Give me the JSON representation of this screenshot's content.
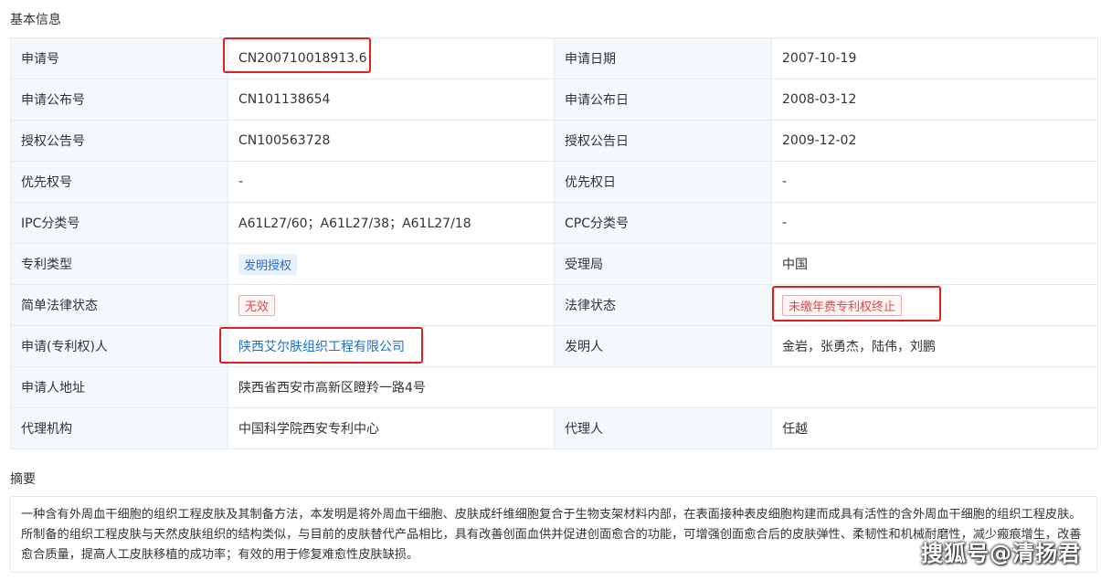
{
  "sections": {
    "basic_info": "基本信息",
    "abstract": "摘要"
  },
  "rows": [
    {
      "label1": "申请号",
      "value1": "CN200710018913.6",
      "label2": "申请日期",
      "value2": "2007-10-19"
    },
    {
      "label1": "申请公布号",
      "value1": "CN101138654",
      "label2": "申请公布日",
      "value2": "2008-03-12"
    },
    {
      "label1": "授权公告号",
      "value1": "CN100563728",
      "label2": "授权公告日",
      "value2": "2009-12-02"
    },
    {
      "label1": "优先权号",
      "value1": "-",
      "label2": "优先权日",
      "value2": "-"
    },
    {
      "label1": "IPC分类号",
      "value1": "A61L27/60；A61L27/38；A61L27/18",
      "label2": "CPC分类号",
      "value2": "-"
    },
    {
      "label1": "专利类型",
      "value1": "发明授权",
      "label2": "受理局",
      "value2": "中国"
    },
    {
      "label1": "简单法律状态",
      "value1": "无效",
      "label2": "法律状态",
      "value2": "未缴年费专利权终止"
    },
    {
      "label1": "申请(专利权)人",
      "value1": "陕西艾尔肤组织工程有限公司",
      "label2": "发明人",
      "value2": "金岩，张勇杰，陆伟，刘鹏"
    },
    {
      "label1": "申请人地址",
      "value1": "陕西省西安市高新区瞪羚一路4号"
    },
    {
      "label1": "代理机构",
      "value1": "中国科学院西安专利中心",
      "label2": "代理人",
      "value2": "任越"
    }
  ],
  "abstract_text": "一种含有外周血干细胞的组织工程皮肤及其制备方法，本发明是将外周血干细胞、皮肤成纤维细胞复合于生物支架材料内部，在表面接种表皮细胞构建而成具有活性的含外周血干细胞的组织工程皮肤。所制备的组织工程皮肤与天然皮肤组织的结构类似，与目前的皮肤替代产品相比，具有改善创面血供并促进创面愈合的功能，可增强创面愈合后的皮肤弹性、柔韧性和机械耐磨性，减少瘢痕增生，改善愈合质量，提高人工皮肤移植的成功率；有效的用于修复难愈性皮肤缺损。",
  "watermark": "搜狐号@清扬君",
  "colors": {
    "label_bg": "#f3f8fc",
    "border": "#e6ebf0",
    "link": "#1e6fc9",
    "highlight": "#e02020",
    "tag_red": "#e04848"
  }
}
